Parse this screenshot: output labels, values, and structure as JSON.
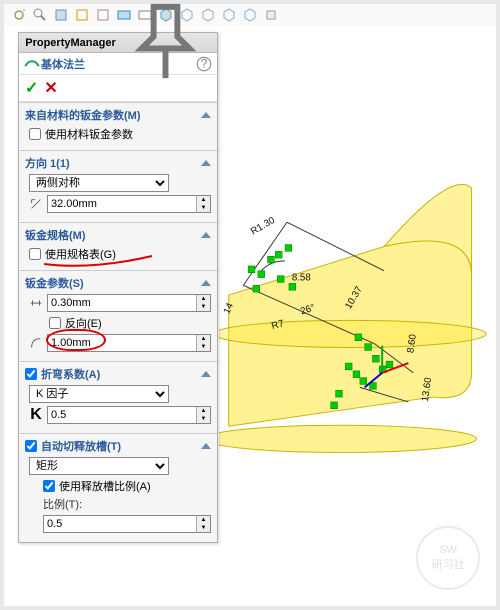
{
  "header": {
    "title": "PropertyManager"
  },
  "feature": {
    "name": "基体法兰"
  },
  "material": {
    "title": "来自材料的钣金参数(M)",
    "use_label": "使用材料钣金参数"
  },
  "direction": {
    "title": "方向 1(1)",
    "mode": "两侧对称",
    "depth": "32.00mm"
  },
  "gauge": {
    "title": "钣金规格(M)",
    "use_label": "使用规格表(G)"
  },
  "sheet": {
    "title": "钣金参数(S)",
    "thickness": "0.30mm",
    "reverse_label": "反向(E)",
    "bend_radius": "1.00mm"
  },
  "bend": {
    "title": "折弯系数(A)",
    "method": "K 因子",
    "k_symbol": "K",
    "k_value": "0.5"
  },
  "relief": {
    "title": "自动切释放槽(T)",
    "type": "矩形",
    "ratio_cb": "使用释放槽比例(A)",
    "ratio_label": "比例(T):",
    "ratio": "0.5"
  },
  "toolbar": {
    "icons": [
      "rotate",
      "zoom",
      "section",
      "prev",
      "next",
      "shade",
      "wire",
      "edges",
      "iso1",
      "iso2",
      "iso3",
      "iso4",
      "view",
      "fit",
      "custom"
    ]
  },
  "sketch_dims": {
    "r1": "R1.30",
    "d1": "8.58",
    "a1": "26°",
    "d2": "10.37",
    "r2": "R7",
    "h1": "13.60",
    "h2": "8.60",
    "d3": "14"
  },
  "watermark": {
    "l1": "SW",
    "l2": "研习社"
  }
}
